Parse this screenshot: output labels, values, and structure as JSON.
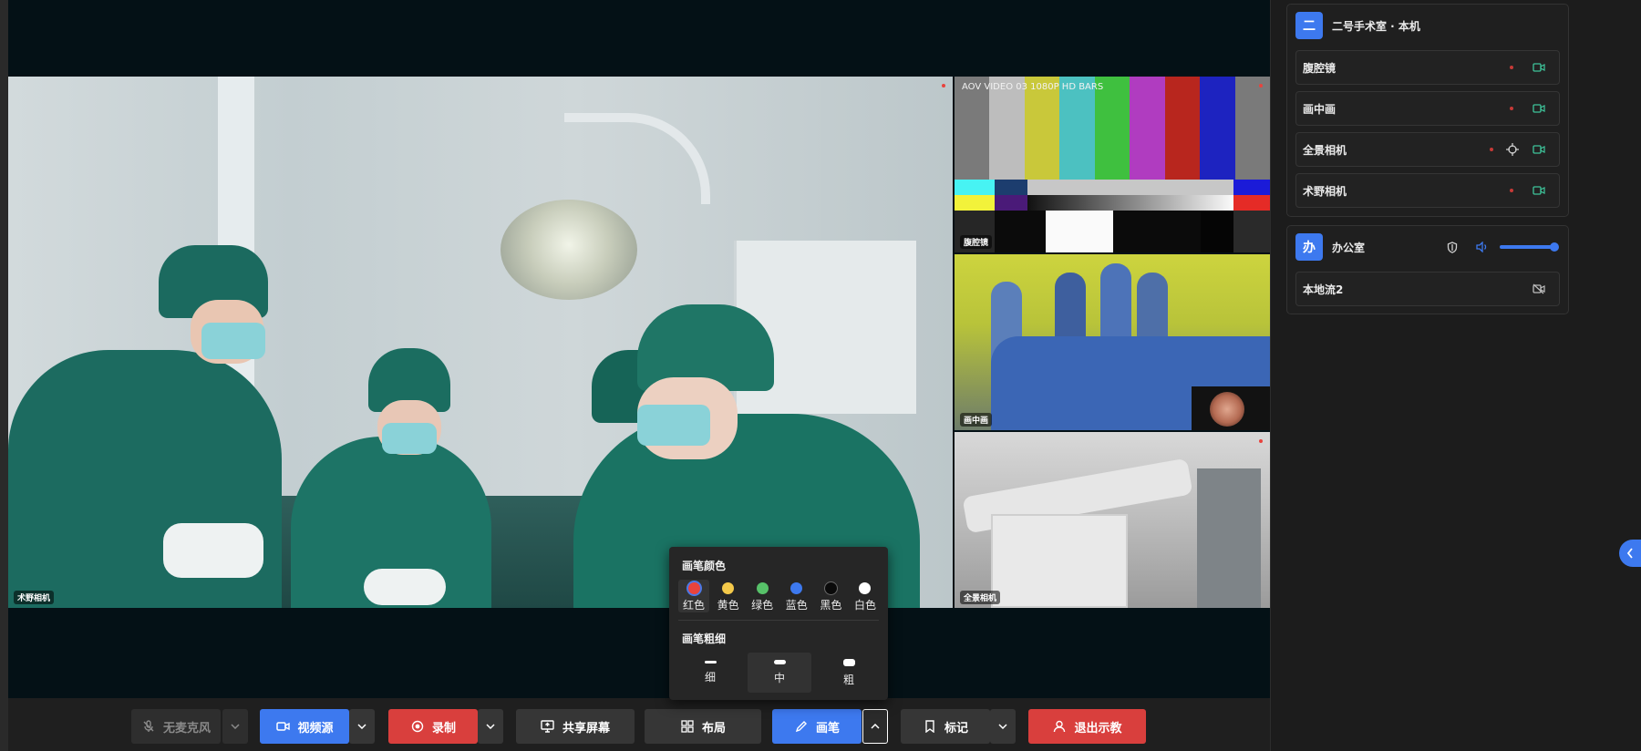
{
  "room": {
    "badge": "二",
    "title": "二号手术室 · 本机",
    "sources": [
      {
        "label": "腹腔镜",
        "target": false
      },
      {
        "label": "画中画",
        "target": false
      },
      {
        "label": "全景相机",
        "target": true
      },
      {
        "label": "术野相机",
        "target": false
      }
    ]
  },
  "office": {
    "badge": "办",
    "title": "办公室",
    "volume": 1.0,
    "stream": "本地流2"
  },
  "tiles": {
    "main": "术野相机",
    "bars": "腹腔镜",
    "bars_caption": "AOV VIDEO 03   1080P HD BARS",
    "overlay": "画中画",
    "panorama": "全景相机"
  },
  "toolbar": {
    "mic": "无麦克风",
    "video": "视频源",
    "record": "录制",
    "share": "共享屏幕",
    "layout": "布局",
    "pen": "画笔",
    "mark": "标记",
    "exit": "退出示教"
  },
  "pen_popover": {
    "color_title": "画笔颜色",
    "size_title": "画笔粗细",
    "colors": [
      {
        "label": "红色",
        "hex": "#e8433d",
        "selected": true
      },
      {
        "label": "黄色",
        "hex": "#f4c94a",
        "selected": false
      },
      {
        "label": "绿色",
        "hex": "#57c169",
        "selected": false
      },
      {
        "label": "蓝色",
        "hex": "#3d79ef",
        "selected": false
      },
      {
        "label": "黑色",
        "hex": "#0a0a0a",
        "selected": false
      },
      {
        "label": "白色",
        "hex": "#ffffff",
        "selected": false
      }
    ],
    "sizes": [
      {
        "label": "细",
        "selected": false
      },
      {
        "label": "中",
        "selected": true
      },
      {
        "label": "粗",
        "selected": false
      }
    ]
  },
  "colors": {
    "accent": "#3d79ef",
    "danger": "#d93f3d",
    "record_dot": "#e8433d",
    "camera_icon": "#3ec49a"
  }
}
